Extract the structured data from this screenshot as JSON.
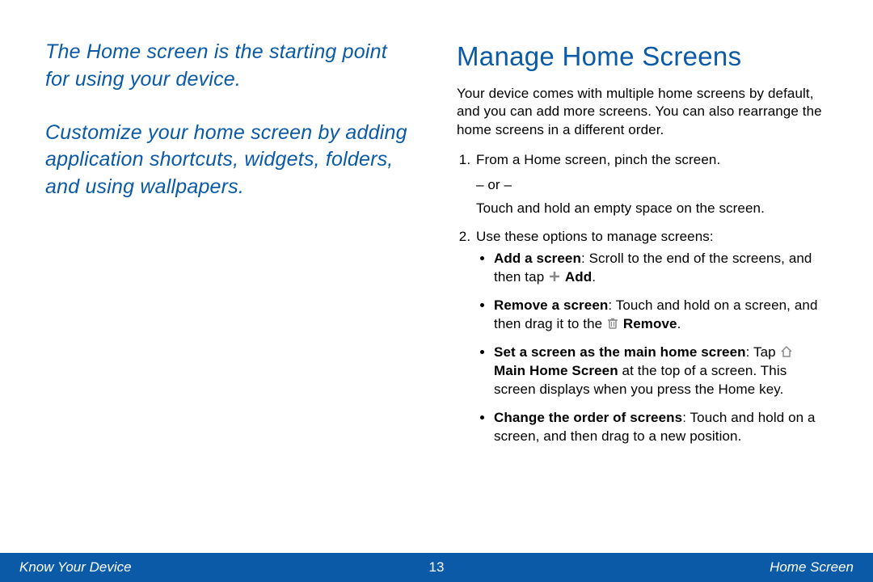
{
  "intro": {
    "p1": "The Home screen is the starting point for using your device.",
    "p2": "Customize your home screen by adding application shortcuts, widgets, folders, and using wallpapers."
  },
  "main": {
    "heading": "Manage Home Screens",
    "lead": "Your device comes with multiple home screens by default, and you can add more screens. You can also rearrange the home screens in a different order.",
    "step1a": "From a Home screen, pinch the screen.",
    "or": "– or –",
    "step1b": "Touch and hold an empty space on the screen.",
    "step2": "Use these options to manage screens:",
    "bullets": {
      "add": {
        "label": "Add a screen",
        "t1": ": Scroll to the end of the screens, and then tap ",
        "btn": "Add",
        "t2": "."
      },
      "remove": {
        "label": "Remove a screen",
        "t1": ": Touch and hold on a screen, and then drag it to the ",
        "btn": "Remove",
        "t2": "."
      },
      "main_home": {
        "label": "Set a screen as the main home screen",
        "t1": ": Tap ",
        "btn": "Main Home Screen",
        "t2": " at the top of a screen. This screen displays when you press the Home key."
      },
      "order": {
        "label": "Change the order of screens",
        "t1": ": Touch and hold on a screen, and then drag to a new position."
      }
    }
  },
  "footer": {
    "left": "Know Your Device",
    "page": "13",
    "right": "Home Screen"
  }
}
